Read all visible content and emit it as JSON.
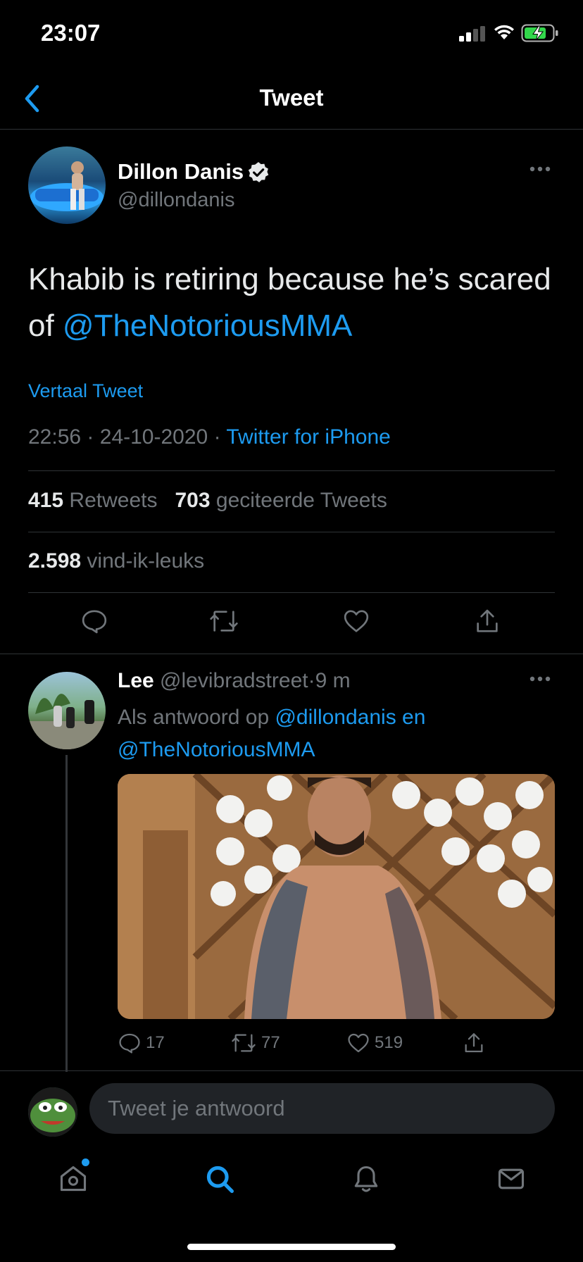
{
  "status_bar": {
    "time": "23:07"
  },
  "header": {
    "title": "Tweet"
  },
  "tweet": {
    "author_name": "Dillon Danis",
    "author_handle": "@dillondanis",
    "text_plain": "Khabib is retiring because he’s scared of ",
    "text_mention": "@TheNotoriousMMA",
    "translate_label": "Vertaal Tweet",
    "time": "22:56",
    "date": "24-10-2020",
    "separator": "·",
    "source": "Twitter for iPhone",
    "retweets_count": "415",
    "retweets_label": "Retweets",
    "quotes_count": "703",
    "quotes_label": "geciteerde Tweets",
    "likes_count": "2.598",
    "likes_label": "vind-ik-leuks"
  },
  "reply": {
    "name": "Lee",
    "handle": "@levibradstreet",
    "separator": "·",
    "time_ago": "9 m",
    "context_prefix": "Als antwoord op ",
    "context_mentions": "@dillondanis en @TheNotoriousMMA",
    "reply_count": "17",
    "retweet_count": "77",
    "like_count": "519"
  },
  "compose": {
    "placeholder": "Tweet je antwoord"
  },
  "colors": {
    "accent": "#1d9bf0",
    "background": "#000000",
    "secondary_text": "#71767b",
    "divider": "#2f3336"
  },
  "icons": [
    "back-chevron-icon",
    "verified-badge-icon",
    "more-icon",
    "reply-icon",
    "retweet-icon",
    "like-icon",
    "share-icon",
    "home-icon",
    "search-icon",
    "notifications-icon",
    "messages-icon"
  ]
}
